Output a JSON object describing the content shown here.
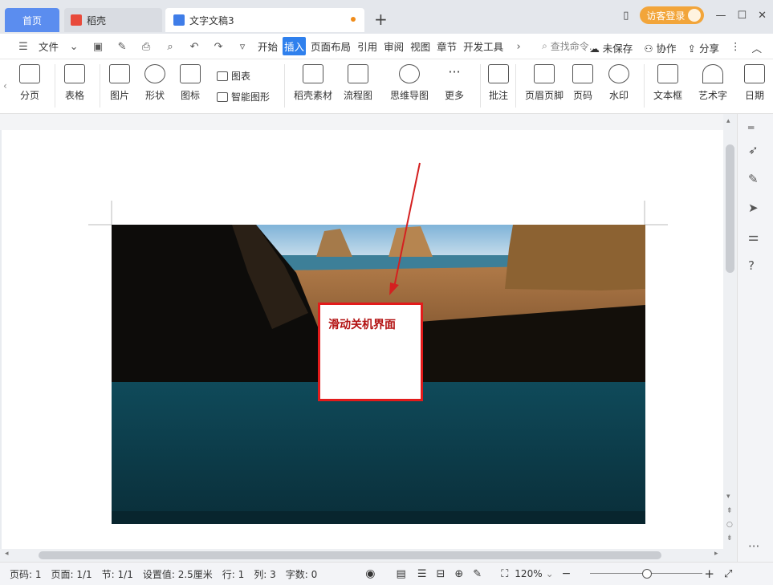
{
  "tabs": {
    "home": "首页",
    "daoke": "稻壳",
    "doc": "文字文稿3",
    "new": "+"
  },
  "window": {
    "login": "访客登录"
  },
  "menubar": {
    "file": "文件",
    "items": [
      "开始",
      "插入",
      "页面布局",
      "引用",
      "审阅",
      "视图",
      "章节",
      "开发工具"
    ],
    "active_index": 1,
    "search_placeholder": "查找命令...",
    "unsaved": "未保存",
    "collab": "协作",
    "share": "分享"
  },
  "ribbon": {
    "page_break": "分页",
    "table": "表格",
    "picture": "图片",
    "shape": "形状",
    "icon": "图标",
    "chart": "图表",
    "smart_art": "智能图形",
    "daoke_material": "稻壳素材",
    "flowchart": "流程图",
    "mindmap": "思维导图",
    "more": "更多",
    "comment": "批注",
    "header_footer": "页眉页脚",
    "page_number": "页码",
    "watermark": "水印",
    "textbox": "文本框",
    "wordart": "艺术字",
    "date": "日期"
  },
  "document": {
    "callout_text": "滑动关机界面"
  },
  "statusbar": {
    "page_num": "页码: 1",
    "page": "页面: 1/1",
    "section": "节: 1/1",
    "setting": "设置值: 2.5厘米",
    "row": "行: 1",
    "col": "列: 3",
    "words": "字数: 0",
    "zoom": "120%"
  },
  "zoom_slider_fraction": 0.6,
  "colors": {
    "accent": "#2f80ed",
    "home_tab": "#5b8def",
    "login": "#f2a53a",
    "callout_border": "#e21b1b",
    "arrow": "#d42020"
  }
}
